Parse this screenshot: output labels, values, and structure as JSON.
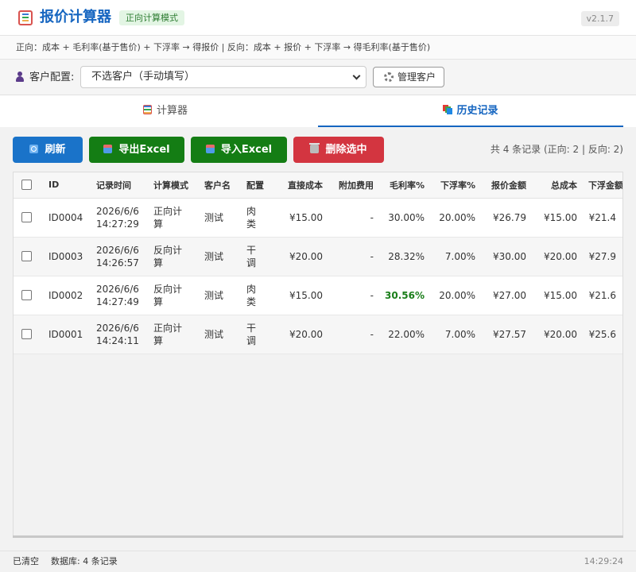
{
  "header": {
    "title": "报价计算器",
    "mode_badge": "正向计算模式",
    "version": "v2.1.7"
  },
  "formula": "正向：成本 + 毛利率(基于售价) + 下浮率 → 得报价  |  反向：成本 + 报价 + 下浮率 → 得毛利率(基于售价)",
  "customer": {
    "label": "客户配置:",
    "selected": "不选客户（手动填写）",
    "manage_label": "管理客户"
  },
  "tabs": [
    {
      "label": "计算器"
    },
    {
      "label": "历史记录"
    }
  ],
  "toolbar": {
    "refresh": "刷新",
    "export": "导出Excel",
    "import": "导入Excel",
    "delete": "删除选中",
    "summary": "共 4 条记录 (正向: 2 | 反向: 2)"
  },
  "table": {
    "headers": [
      "ID",
      "记录时间",
      "计算模式",
      "客户名",
      "配置",
      "直接成本",
      "附加费用",
      "毛利率%",
      "下浮率%",
      "报价金额",
      "总成本",
      "下浮金额"
    ],
    "rows": [
      {
        "id": "ID0004",
        "date": "2026/6/6",
        "time": "14:27:29",
        "mode": "正向计算",
        "customer": "测试",
        "config": "肉类",
        "direct_cost": "¥15.00",
        "extra": "-",
        "margin": "30.00%",
        "discount": "20.00%",
        "quote": "¥26.79",
        "total_cost": "¥15.00",
        "discount_amount": "¥21.4"
      },
      {
        "id": "ID0003",
        "date": "2026/6/6",
        "time": "14:26:57",
        "mode": "反向计算",
        "customer": "测试",
        "config": "干调",
        "direct_cost": "¥20.00",
        "extra": "-",
        "margin": "28.32%",
        "discount": "7.00%",
        "quote": "¥30.00",
        "total_cost": "¥20.00",
        "discount_amount": "¥27.9"
      },
      {
        "id": "ID0002",
        "date": "2026/6/6",
        "time": "14:27:49",
        "mode": "反向计算",
        "customer": "测试",
        "config": "肉类",
        "direct_cost": "¥15.00",
        "extra": "-",
        "margin": "30.56%",
        "discount": "20.00%",
        "quote": "¥27.00",
        "total_cost": "¥15.00",
        "discount_amount": "¥21.6"
      },
      {
        "id": "ID0001",
        "date": "2026/6/6",
        "time": "14:24:11",
        "mode": "正向计算",
        "customer": "测试",
        "config": "干调",
        "direct_cost": "¥20.00",
        "extra": "-",
        "margin": "22.00%",
        "discount": "7.00%",
        "quote": "¥27.57",
        "total_cost": "¥20.00",
        "discount_amount": "¥25.6"
      }
    ]
  },
  "status": {
    "left": "已清空",
    "db": "数据库: 4 条记录",
    "time": "14:29:24"
  },
  "colors": {
    "primary": "#1565c0",
    "green": "#147d14",
    "red": "#d33540",
    "blue_button": "#1a73c9"
  }
}
